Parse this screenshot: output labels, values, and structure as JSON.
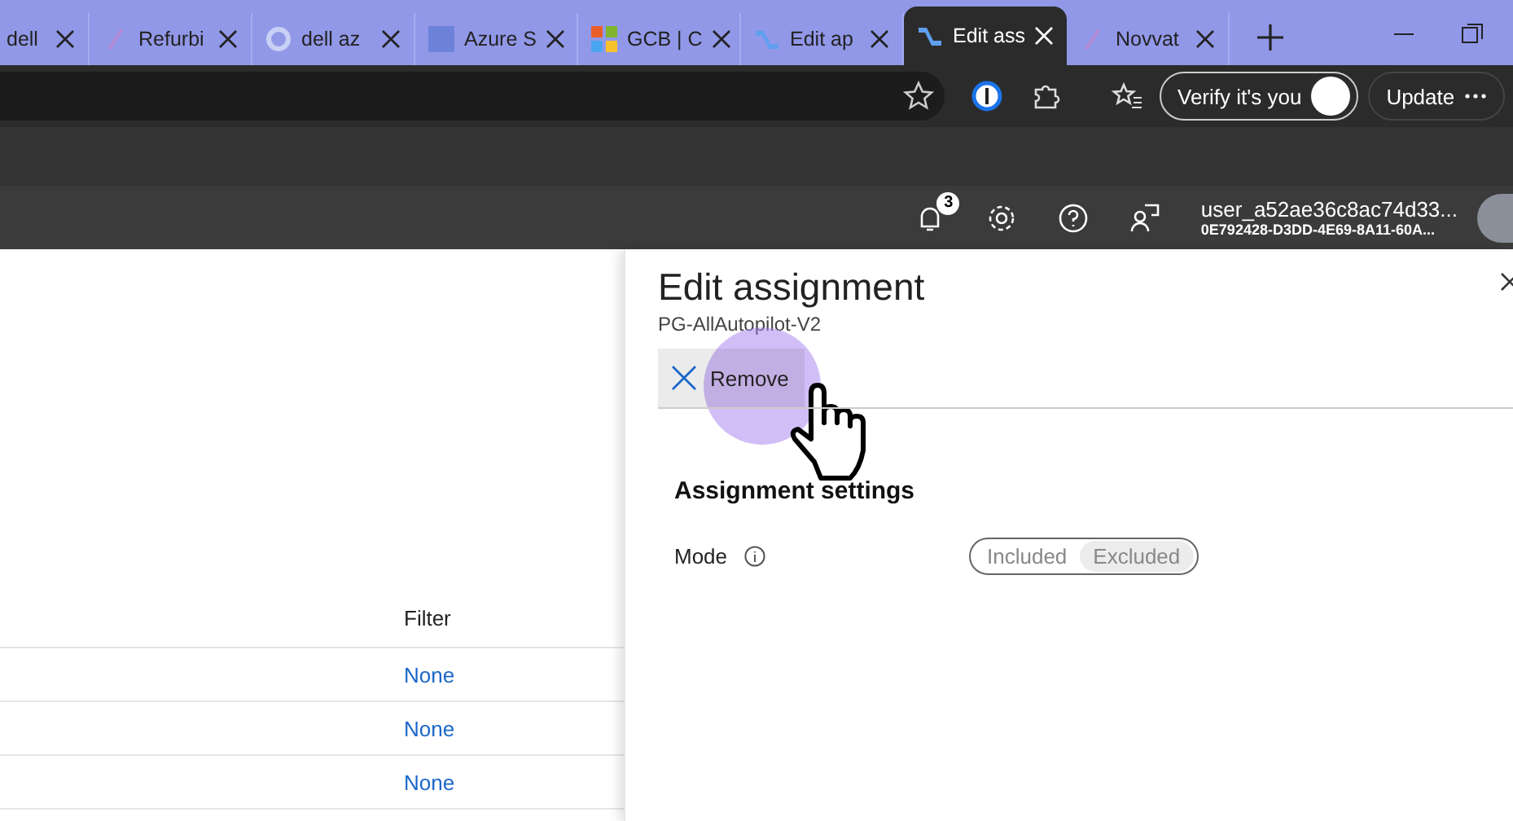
{
  "browser": {
    "tabs": [
      {
        "label": "dell",
        "selected": false
      },
      {
        "label": "Refurbi",
        "selected": false,
        "kind": "generic"
      },
      {
        "label": "dell az",
        "selected": false,
        "kind": "google"
      },
      {
        "label": "Azure S",
        "selected": false,
        "kind": "dell"
      },
      {
        "label": "GCB | C",
        "selected": false,
        "kind": "microsoft"
      },
      {
        "label": "Edit ap",
        "selected": false,
        "kind": "intune"
      },
      {
        "label": "Edit ass",
        "selected": true,
        "kind": "intune"
      },
      {
        "label": "Novvat",
        "selected": false,
        "kind": "generic"
      }
    ],
    "verify_button": "Verify it's you",
    "update_button": "Update"
  },
  "portal_header": {
    "notification_count": "3",
    "user_name": "user_a52ae36c8ac74d33...",
    "tenant": "0E792428-D3DD-4E69-8A11-60A..."
  },
  "table": {
    "columns": [
      "Filter"
    ],
    "rows": [
      {
        "filter": "None"
      },
      {
        "filter": "None"
      },
      {
        "filter": "None"
      }
    ]
  },
  "panel": {
    "title": "Edit assignment",
    "subtitle": "PG-AllAutopilot-V2",
    "remove_button": "Remove",
    "section_title": "Assignment settings",
    "mode_label": "Mode",
    "mode_options": [
      {
        "label": "Included",
        "selected": false
      },
      {
        "label": "Excluded",
        "selected": true
      }
    ]
  }
}
